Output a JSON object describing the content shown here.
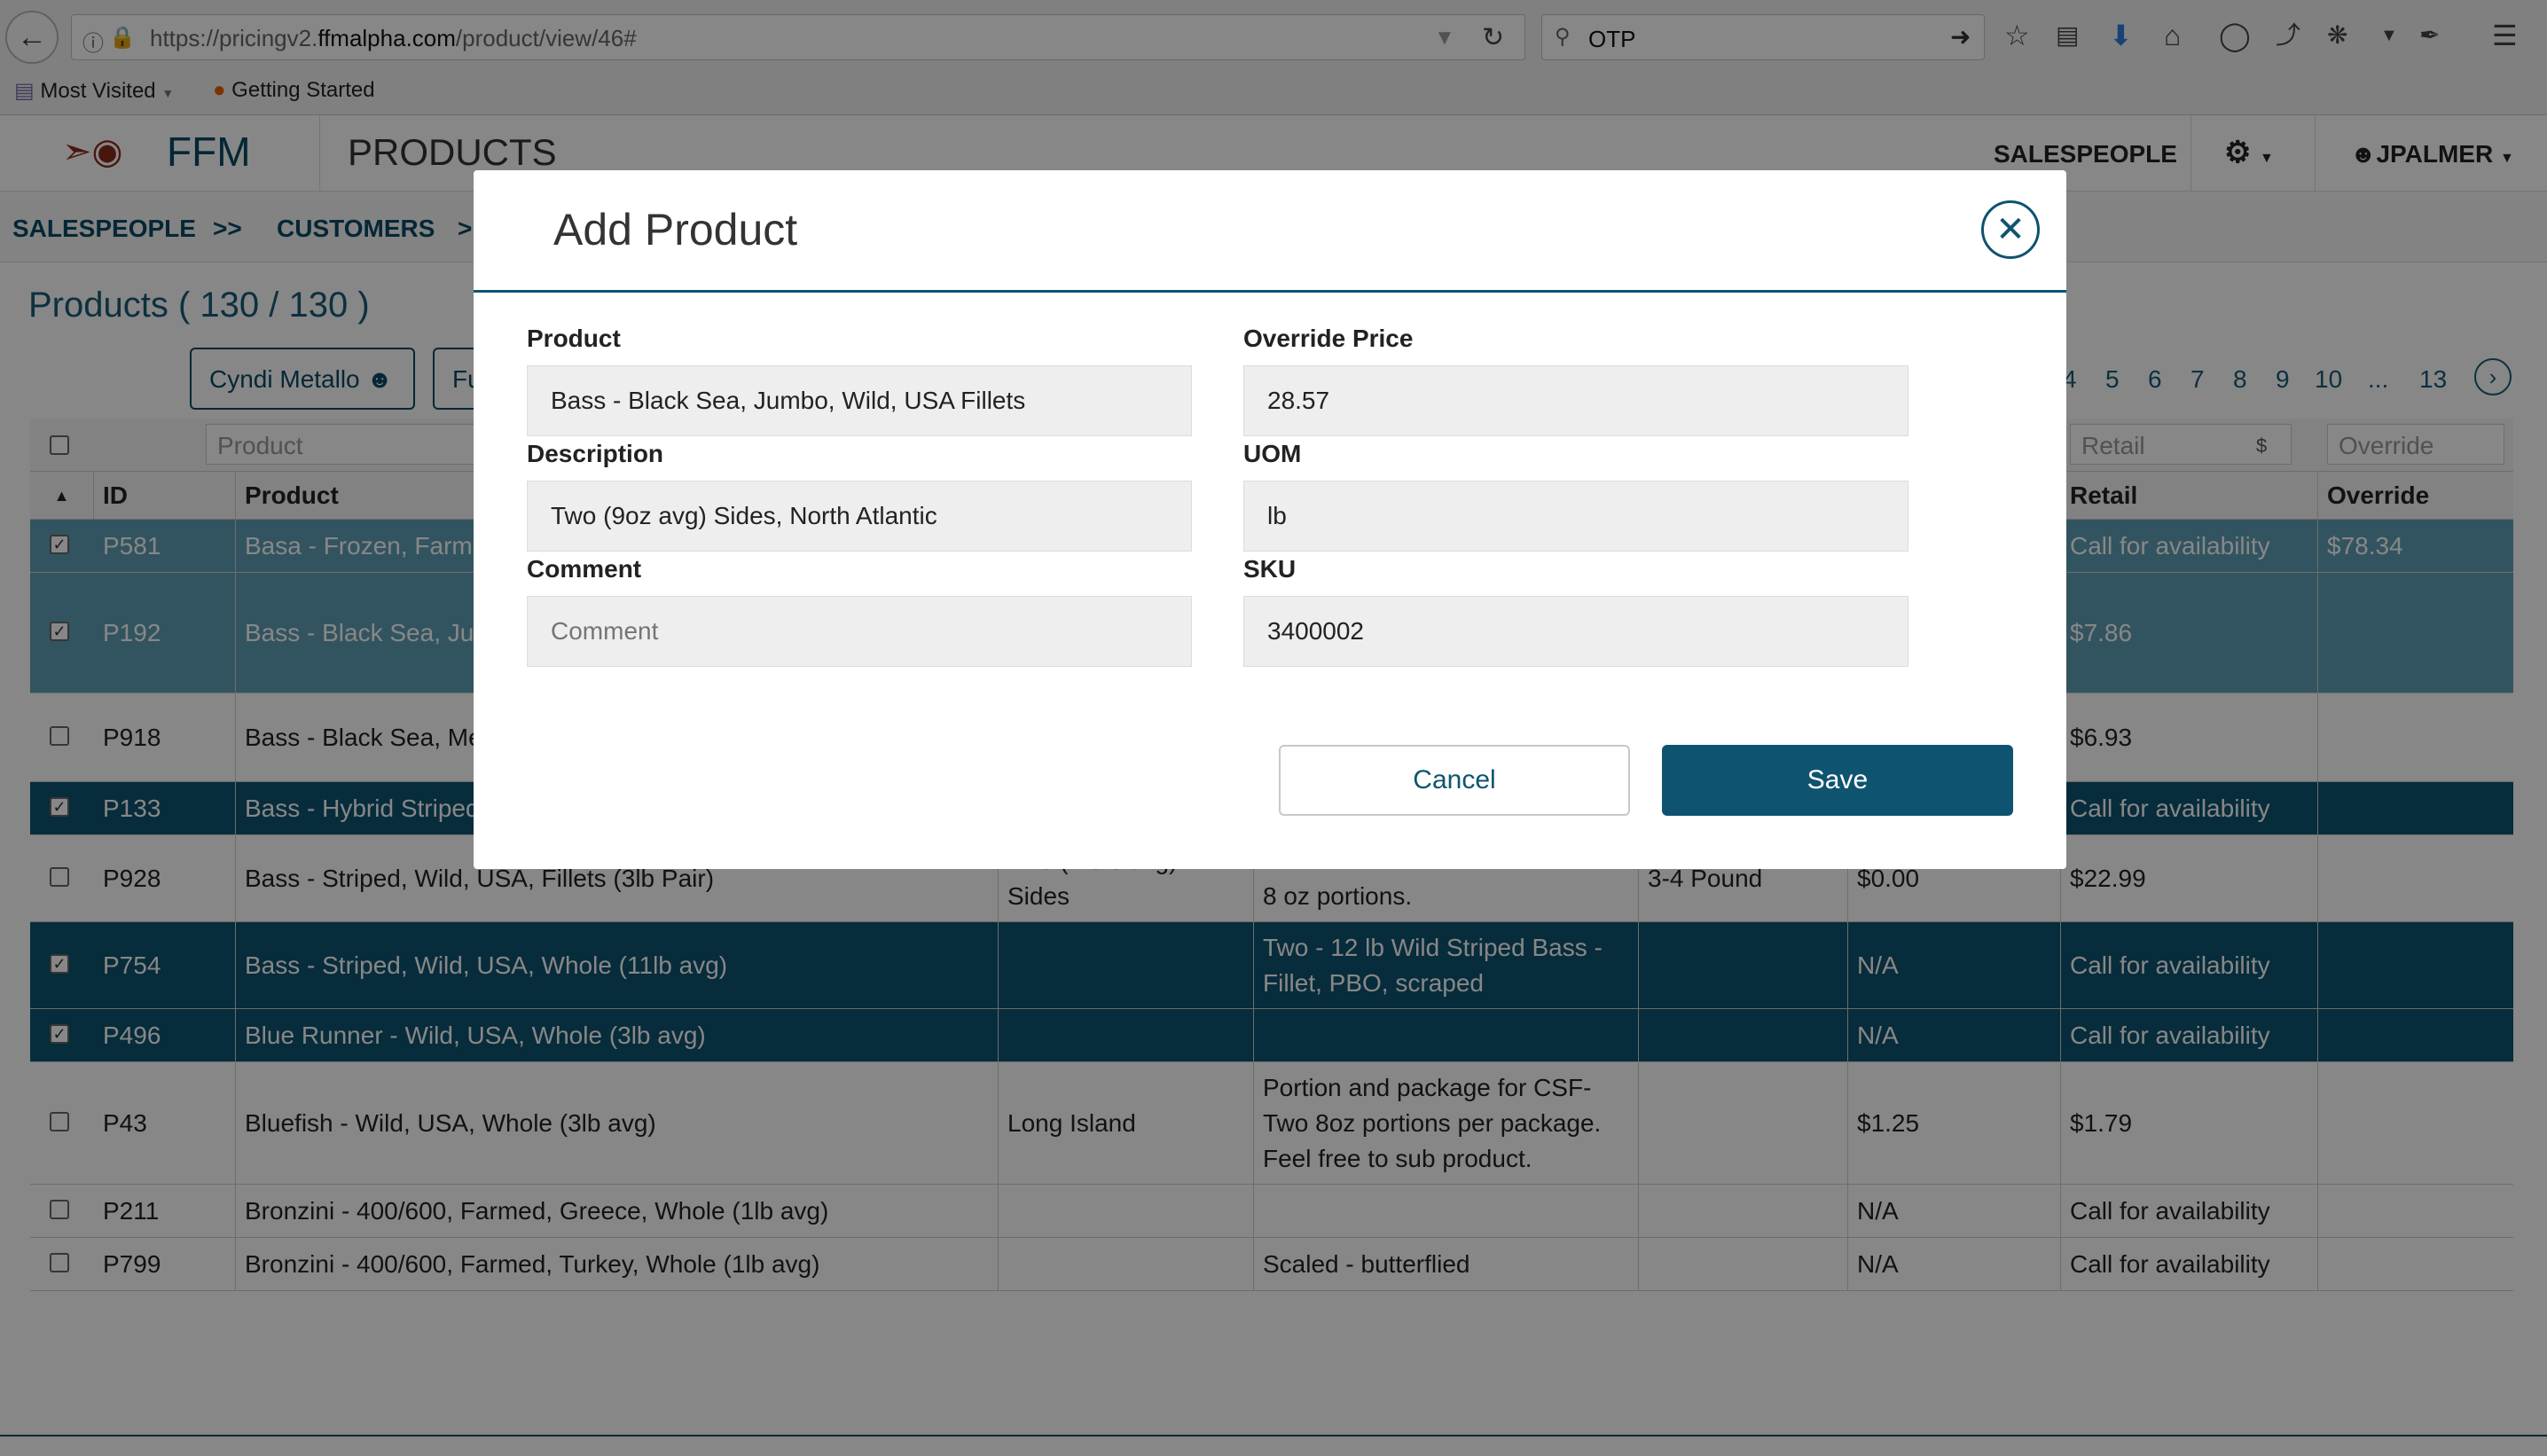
{
  "browser": {
    "url_prefix": "https://pricingv2.",
    "url_domain": "ffmalpha.com",
    "url_path": "/product/view/46#",
    "search_query": "OTP",
    "bookmarks": [
      "Most Visited",
      "Getting Started"
    ]
  },
  "navbar": {
    "brand": "FFM",
    "section": "PRODUCTS",
    "salespeople": "SALESPEOPLE",
    "user": "JPALMER"
  },
  "breadcrumb": {
    "items": [
      "SALESPEOPLE",
      ">>",
      "CUSTOMERS",
      ">"
    ]
  },
  "page": {
    "title": "Products ( 130 / 130 )",
    "salesperson_button": "Cyndi Metallo",
    "second_button": "Fu",
    "pagination": [
      "4",
      "5",
      "6",
      "7",
      "8",
      "9",
      "10",
      "...",
      "13"
    ]
  },
  "table": {
    "filters": {
      "product": "Product",
      "retail": "Retail",
      "override": "Override"
    },
    "headers": {
      "id": "ID",
      "product": "Product",
      "retail": "Retail",
      "override": "Override"
    },
    "rows": [
      {
        "id": "P581",
        "product": "Basa - Frozen, Farmed, V",
        "origin": "",
        "notes": "",
        "size": "",
        "cost": "",
        "retail": "Call for availability",
        "override": "$78.34",
        "checked": true
      },
      {
        "id": "P192",
        "product": "Bass - Black Sea, Jumbo",
        "origin": "",
        "notes": "",
        "size": "",
        "cost": "",
        "retail": "$7.86",
        "override": "",
        "checked": true
      },
      {
        "id": "P918",
        "product": "Bass - Black Sea, Mediu",
        "origin": "",
        "notes": "",
        "size": "",
        "cost": "",
        "retail": "$6.93",
        "override": "",
        "checked": false
      },
      {
        "id": "P133",
        "product": "Bass - Hybrid Striped, Fa",
        "origin": "",
        "notes": "",
        "size": "",
        "cost": "",
        "retail": "Call for availability",
        "override": "",
        "checked": true
      },
      {
        "id": "P928",
        "product": "Bass - Striped, Wild, USA, Fillets (3lb Pair)",
        "origin": "Two (1.5lb avg) Sides",
        "notes": "8 oz portions.",
        "size": "3-4 Pound",
        "cost": "$0.00",
        "retail": "$22.99",
        "override": "",
        "checked": false
      },
      {
        "id": "P754",
        "product": "Bass - Striped, Wild, USA, Whole (11lb avg)",
        "origin": "",
        "notes": "Two - 12 lb Wild Striped Bass - Fillet, PBO, scraped",
        "size": "",
        "cost": "N/A",
        "retail": "Call for availability",
        "override": "",
        "checked": true
      },
      {
        "id": "P496",
        "product": "Blue Runner - Wild, USA, Whole (3lb avg)",
        "origin": "",
        "notes": "",
        "size": "",
        "cost": "N/A",
        "retail": "Call for availability",
        "override": "",
        "checked": true
      },
      {
        "id": "P43",
        "product": "Bluefish - Wild, USA, Whole (3lb avg)",
        "origin": "Long Island",
        "notes": "Portion and package for CSF- Two 8oz portions per package. Feel free to sub product.",
        "size": "",
        "cost": "$1.25",
        "retail": "$1.79",
        "override": "",
        "checked": false
      },
      {
        "id": "P211",
        "product": "Bronzini - 400/600, Farmed, Greece, Whole (1lb avg)",
        "origin": "",
        "notes": "",
        "size": "",
        "cost": "N/A",
        "retail": "Call for availability",
        "override": "",
        "checked": false
      },
      {
        "id": "P799",
        "product": "Bronzini - 400/600, Farmed, Turkey, Whole (1lb avg)",
        "origin": "",
        "notes": "Scaled - butterflied",
        "size": "",
        "cost": "N/A",
        "retail": "Call for availability",
        "override": "",
        "checked": false
      }
    ]
  },
  "modal": {
    "title": "Add Product",
    "product_label": "Product",
    "product_value": "Bass - Black Sea, Jumbo, Wild, USA Fillets",
    "description_label": "Description",
    "description_value": "Two (9oz avg) Sides, North Atlantic",
    "comment_label": "Comment",
    "comment_placeholder": "Comment",
    "override_label": "Override Price",
    "override_value": "28.57",
    "uom_label": "UOM",
    "uom_value": "lb",
    "sku_label": "SKU",
    "sku_value": "3400002",
    "cancel_label": "Cancel",
    "save_label": "Save"
  },
  "colors": {
    "brand": "#0e5470",
    "selected_row": "#5f9fb6",
    "dark_row": "#0e5470"
  }
}
